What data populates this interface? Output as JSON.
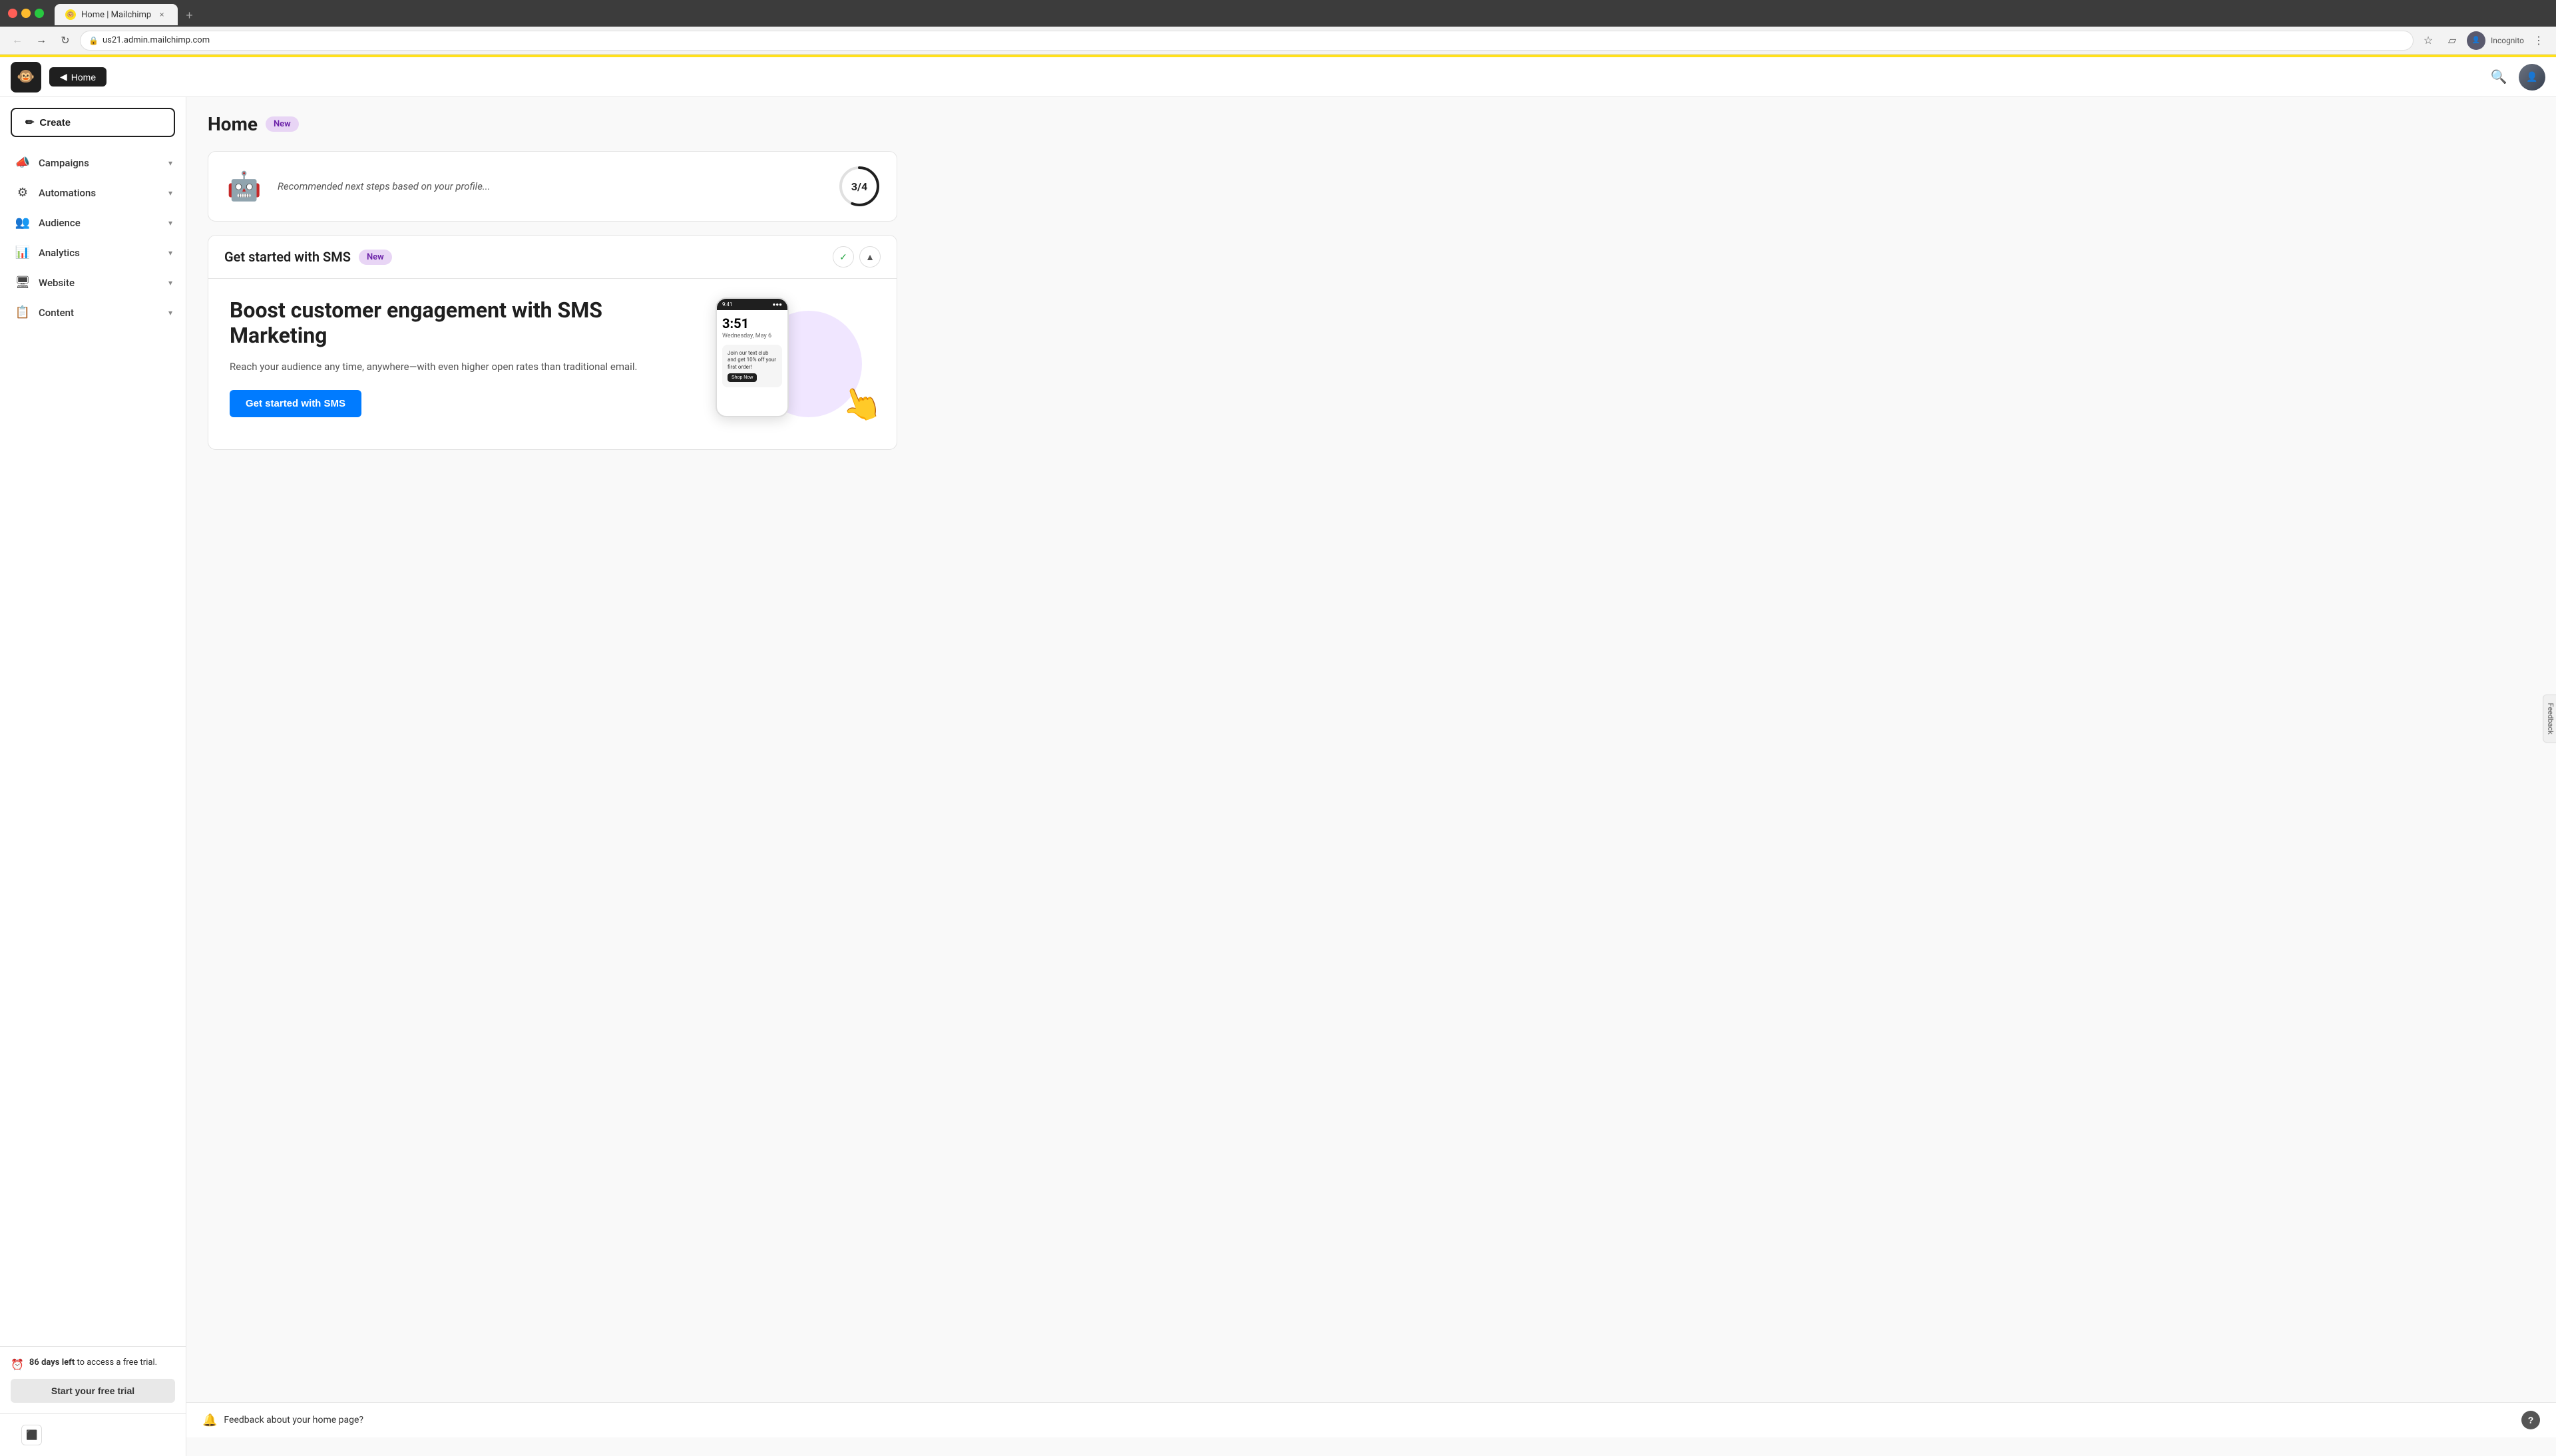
{
  "browser": {
    "tab_title": "Home | Mailchimp",
    "tab_favicon": "🐵",
    "url": "us21.admin.mailchimp.com",
    "window_controls": {
      "close": "×",
      "min": "–",
      "max": "⬜"
    },
    "incognito_label": "Incognito",
    "new_tab_icon": "+"
  },
  "app": {
    "logo_text": "🐵",
    "topbar": {
      "home_label": "Home",
      "home_icon": "◀"
    }
  },
  "sidebar": {
    "create_btn": "Create",
    "create_icon": "✏",
    "nav_items": [
      {
        "id": "campaigns",
        "label": "Campaigns",
        "icon": "📣",
        "has_chevron": true
      },
      {
        "id": "automations",
        "label": "Automations",
        "icon": "⚙",
        "has_chevron": true
      },
      {
        "id": "audience",
        "label": "Audience",
        "icon": "👥",
        "has_chevron": true
      },
      {
        "id": "analytics",
        "label": "Analytics",
        "icon": "📊",
        "has_chevron": true
      },
      {
        "id": "website",
        "label": "Website",
        "icon": "🖥",
        "has_chevron": true
      },
      {
        "id": "content",
        "label": "Content",
        "icon": "📋",
        "has_chevron": true
      }
    ],
    "trial": {
      "days_left": "86 days left",
      "description": " to access a free trial.",
      "start_btn": "Start your free trial"
    }
  },
  "main": {
    "page_title": "Home",
    "new_badge": "New",
    "recommended": {
      "text": "Recommended next steps based on your profile...",
      "progress_current": 3,
      "progress_total": 4,
      "progress_label": "3/4"
    },
    "sms_section": {
      "title": "Get started with SMS",
      "badge": "New",
      "headline": "Boost customer engagement with SMS Marketing",
      "description": "Reach your audience any time, anywhere—with even higher open rates than traditional email.",
      "cta_btn": "Get started with SMS"
    },
    "phone": {
      "time": "3:51",
      "date": "Wednesday, May 6",
      "notification_text": "Join our text club and get 10% off your first order!",
      "shop_btn": "Shop Now"
    }
  },
  "feedback": {
    "text": "Feedback about your home page?",
    "icon": "🔔",
    "help_btn": "?"
  }
}
